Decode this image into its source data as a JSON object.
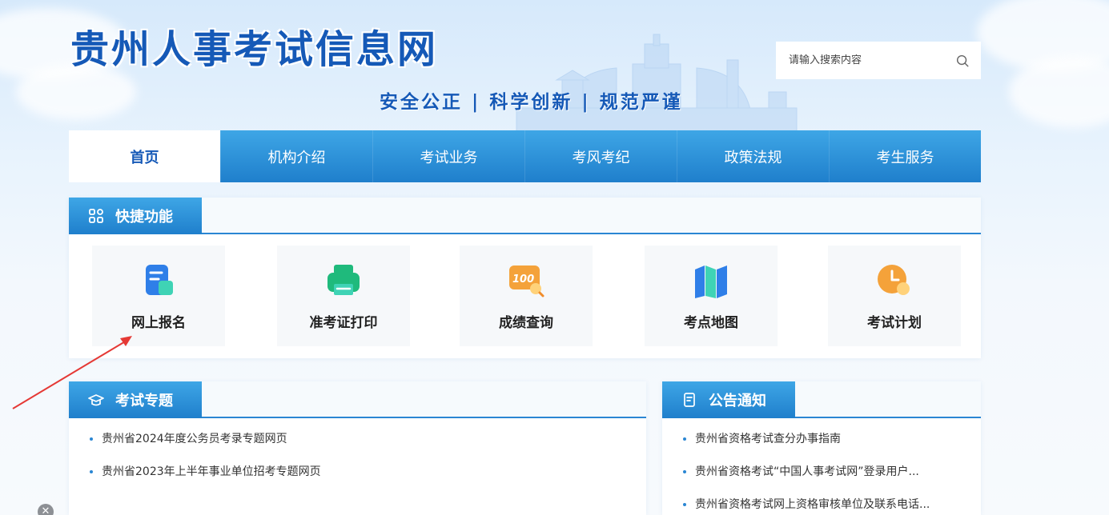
{
  "header": {
    "site_title": "贵州人事考试信息网",
    "slogan": "安全公正 | 科学创新 | 规范严谨",
    "search_placeholder": "请输入搜索内容"
  },
  "nav": {
    "items": [
      {
        "label": "首页",
        "active": true
      },
      {
        "label": "机构介绍"
      },
      {
        "label": "考试业务"
      },
      {
        "label": "考风考纪"
      },
      {
        "label": "政策法规"
      },
      {
        "label": "考生服务"
      }
    ]
  },
  "quick": {
    "title": "快捷功能",
    "items": [
      {
        "label": "网上报名",
        "icon": "form-icon",
        "color": "#2f7fe8"
      },
      {
        "label": "准考证打印",
        "icon": "printer-icon",
        "color": "#1fba7c"
      },
      {
        "label": "成绩查询",
        "icon": "score-icon",
        "color": "#f4a23a",
        "badge": "100"
      },
      {
        "label": "考点地图",
        "icon": "map-icon",
        "color": "#2f7fe8"
      },
      {
        "label": "考试计划",
        "icon": "clock-icon",
        "color": "#f4a23a"
      }
    ]
  },
  "topics": {
    "title": "考试专题",
    "items": [
      "贵州省2024年度公务员考录专题网页",
      "贵州省2023年上半年事业单位招考专题网页"
    ]
  },
  "notices": {
    "title": "公告通知",
    "items": [
      "贵州省资格考试查分办事指南",
      "贵州省资格考试“中国人事考试网”登录用户...",
      "贵州省资格考试网上资格审核单位及联系电话..."
    ]
  },
  "overlay": {
    "close_glyph": "✕"
  },
  "colors": {
    "primary": "#1f7fcc",
    "title": "#1559b7",
    "arrow": "#e53935"
  }
}
